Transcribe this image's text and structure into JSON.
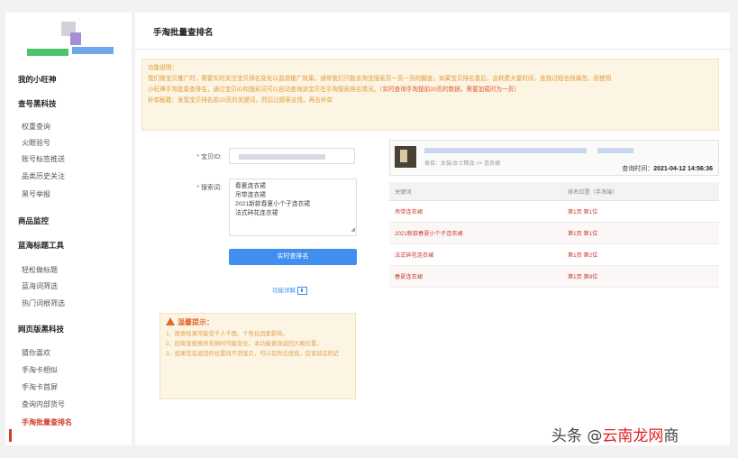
{
  "sidebar": {
    "items": [
      {
        "label": "我的小旺神",
        "group": true
      },
      {
        "label": "查号黑科技",
        "group": true
      },
      {
        "label": "权重查询",
        "group": false
      },
      {
        "label": "火眼验号",
        "group": false
      },
      {
        "label": "账号标签推送",
        "group": false
      },
      {
        "label": "品类历史关注",
        "group": false
      },
      {
        "label": "黑号举报",
        "group": false
      },
      {
        "label": "商品监控",
        "group": true
      },
      {
        "label": "蓝海标题工具",
        "group": true
      },
      {
        "label": "轻松做标题",
        "group": false
      },
      {
        "label": "蓝海词筛选",
        "group": false
      },
      {
        "label": "热门词根筛选",
        "group": false
      },
      {
        "label": "网页版黑科技",
        "group": true
      },
      {
        "label": "猜你喜欢",
        "group": false
      },
      {
        "label": "手淘卡相似",
        "group": false
      },
      {
        "label": "手淘卡首屏",
        "group": false
      },
      {
        "label": "查询内部货号",
        "group": false
      },
      {
        "label": "手淘批量查排名",
        "group": false,
        "active": true
      }
    ]
  },
  "main": {
    "title": "手淘批量查排名",
    "notice": {
      "heading": "功能说明：",
      "line1": "我们做宝贝推广时，需要实时关注宝贝排名变化以监测推广效果。通常我们只能去淘宝搜索页一页一页的翻查。如果宝贝排名靠后，会耗费大量时间，查找过程也很痛苦。而使用",
      "line2a": "小旺神手淘批量查排名，通过宝贝ID和搜索词可以自动查询该宝贝在手淘搜索排名情况。",
      "line2b": "（实时查询手淘搜前20页的数据，需要加载时为一页）",
      "line3": "补单秘籍：发现宝贝排名前20页的关键词，然后让顾客去找，再去补单"
    },
    "form": {
      "id_label": "宝贝ID:",
      "kw_label": "搜索词:",
      "keywords": [
        "春夏连衣裙",
        "吊带连衣裙",
        "2021新款春夏小个子连衣裙",
        "法式碎花连衣裙"
      ],
      "search_button": "实时查排名",
      "func_link": "功能详解"
    },
    "tips": {
      "title": "温馨提示：",
      "line1": "1、搜索结果可能受千人千面、个性化因素影响。",
      "line2": "2、因淘宝搜索排名随时可能变化，本功能查询返回大概位置。",
      "line3": "3、如果您在返回的位置找不到宝贝，可以在附近找找，应该就在附近"
    },
    "result": {
      "category": "类目：女装/女士精品 >> 连衣裙",
      "query_time_label": "查询时间：",
      "query_time": "2021-04-12 14:56:36",
      "columns": [
        "关键词",
        "排名位置（手淘端）"
      ],
      "rows": [
        {
          "keyword": "吊带连衣裙",
          "rank": "第1页 第1位"
        },
        {
          "keyword": "2021新款春夏小个子连衣裙",
          "rank": "第1页 第1位"
        },
        {
          "keyword": "法式碎花连衣裙",
          "rank": "第1页 第2位"
        },
        {
          "keyword": "春夏连衣裙",
          "rank": "第1页 第8位"
        }
      ]
    }
  },
  "watermark": {
    "prefix": "头条 @",
    "highlight": "云南龙网",
    "suffix": "商"
  },
  "colors": {
    "accent": "#3f8ef0",
    "rank_red": "#c9382c",
    "notice_bg": "#fdf5e3",
    "active_red": "#d23b2a"
  }
}
